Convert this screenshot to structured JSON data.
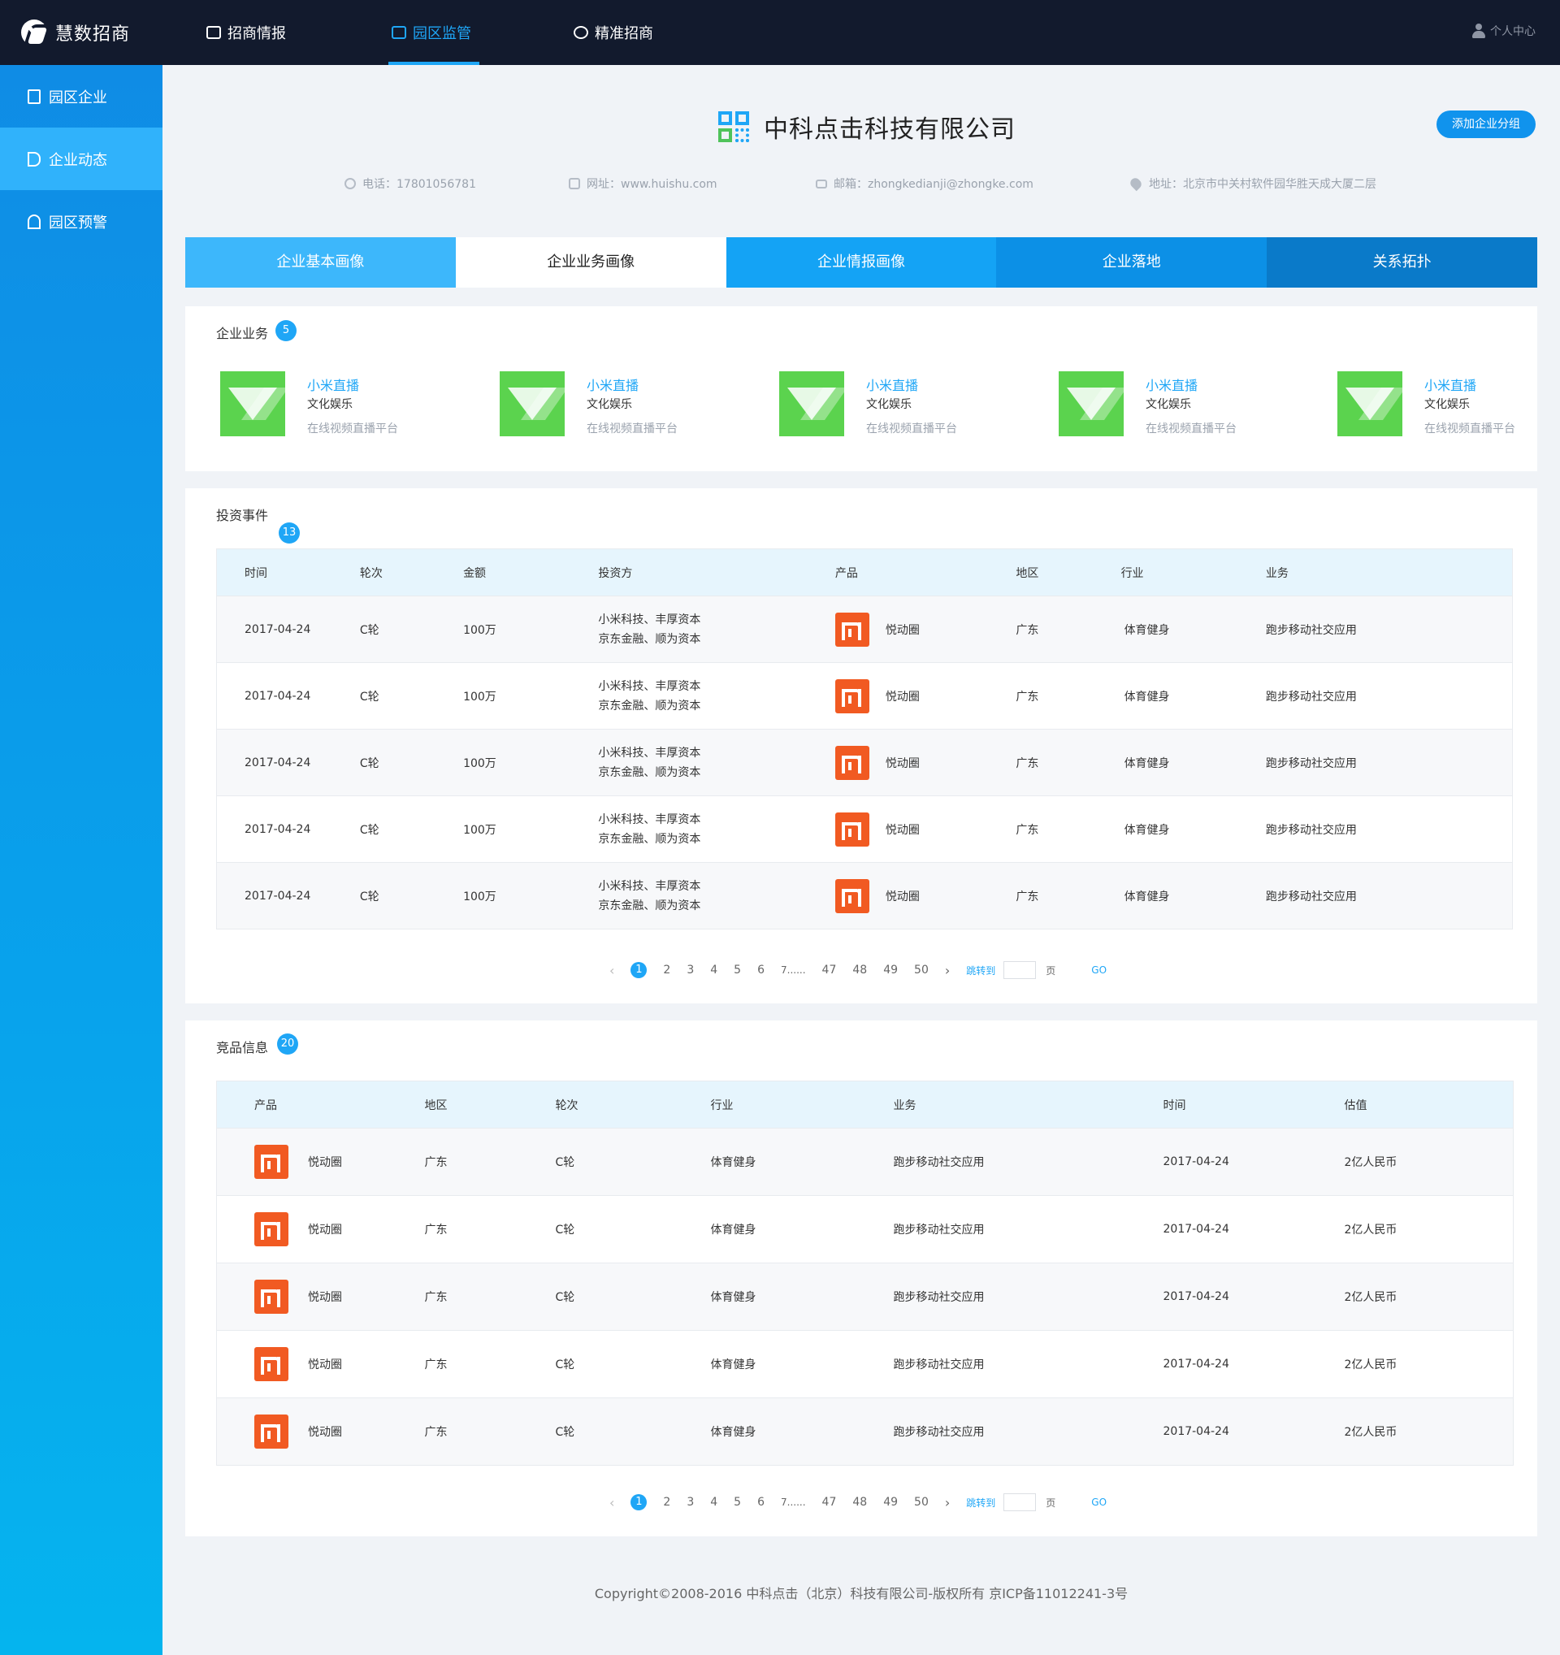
{
  "app": {
    "name": "慧数招商"
  },
  "topnav": [
    {
      "label": "招商情报",
      "icon": "briefcase-icon",
      "active": false
    },
    {
      "label": "园区监管",
      "icon": "buildings-icon",
      "active": true
    },
    {
      "label": "精准招商",
      "icon": "target-icon",
      "active": false
    }
  ],
  "user": {
    "label": "个人中心"
  },
  "sidebar": {
    "items": [
      {
        "label": "园区企业",
        "icon": "building-icon"
      },
      {
        "label": "企业动态",
        "icon": "speaker-icon",
        "active": true
      },
      {
        "label": "园区预警",
        "icon": "alarm-icon"
      }
    ]
  },
  "company": {
    "name": "中科点击科技有限公司",
    "add_group_label": "添加企业分组",
    "phone": "电话：17801056781",
    "website": "网址：www.huishu.com",
    "email": "邮箱：zhongkedianji@zhongke.com",
    "address": "地址：北京市中关村软件园华胜天成大厦二层"
  },
  "tabs": [
    {
      "label": "企业基本画像",
      "bg": "#3db7fb",
      "color": "#ffffff"
    },
    {
      "label": "企业业务画像",
      "bg": "#ffffff",
      "color": "#222222"
    },
    {
      "label": "企业情报画像",
      "bg": "#14a3f5",
      "color": "#ffffff"
    },
    {
      "label": "企业落地",
      "bg": "#0c90e6",
      "color": "#ffffff"
    },
    {
      "label": "关系拓扑",
      "bg": "#0a7ac9",
      "color": "#ffffff"
    }
  ],
  "business": {
    "title": "企业业务",
    "count": "5",
    "items": [
      {
        "name": "小米直播",
        "category": "文化娱乐",
        "desc": "在线视频直播平台"
      },
      {
        "name": "小米直播",
        "category": "文化娱乐",
        "desc": "在线视频直播平台"
      },
      {
        "name": "小米直播",
        "category": "文化娱乐",
        "desc": "在线视频直播平台"
      },
      {
        "name": "小米直播",
        "category": "文化娱乐",
        "desc": "在线视频直播平台"
      },
      {
        "name": "小米直播",
        "category": "文化娱乐",
        "desc": "在线视频直播平台"
      }
    ]
  },
  "investments": {
    "title": "投资事件",
    "count": "13",
    "headers": [
      "时间",
      "轮次",
      "金额",
      "投资方",
      "产品",
      "地区",
      "行业",
      "业务"
    ],
    "rows": [
      {
        "date": "2017-04-24",
        "round": "C轮",
        "amount": "100万",
        "investors1": "小米科技、丰厚资本",
        "investors2": "京东金融、顺为资本",
        "product": "悦动圈",
        "region": "广东",
        "industry": "体育健身",
        "business": "跑步移动社交应用"
      },
      {
        "date": "2017-04-24",
        "round": "C轮",
        "amount": "100万",
        "investors1": "小米科技、丰厚资本",
        "investors2": "京东金融、顺为资本",
        "product": "悦动圈",
        "region": "广东",
        "industry": "体育健身",
        "business": "跑步移动社交应用"
      },
      {
        "date": "2017-04-24",
        "round": "C轮",
        "amount": "100万",
        "investors1": "小米科技、丰厚资本",
        "investors2": "京东金融、顺为资本",
        "product": "悦动圈",
        "region": "广东",
        "industry": "体育健身",
        "business": "跑步移动社交应用"
      },
      {
        "date": "2017-04-24",
        "round": "C轮",
        "amount": "100万",
        "investors1": "小米科技、丰厚资本",
        "investors2": "京东金融、顺为资本",
        "product": "悦动圈",
        "region": "广东",
        "industry": "体育健身",
        "business": "跑步移动社交应用"
      },
      {
        "date": "2017-04-24",
        "round": "C轮",
        "amount": "100万",
        "investors1": "小米科技、丰厚资本",
        "investors2": "京东金融、顺为资本",
        "product": "悦动圈",
        "region": "广东",
        "industry": "体育健身",
        "business": "跑步移动社交应用"
      }
    ]
  },
  "competitors": {
    "title": "竞品信息",
    "count": "20",
    "headers": [
      "产品",
      "地区",
      "轮次",
      "行业",
      "业务",
      "时间",
      "估值"
    ],
    "rows": [
      {
        "product": "悦动圈",
        "region": "广东",
        "round": "C轮",
        "industry": "体育健身",
        "business": "跑步移动社交应用",
        "date": "2017-04-24",
        "valuation": "2亿人民币"
      },
      {
        "product": "悦动圈",
        "region": "广东",
        "round": "C轮",
        "industry": "体育健身",
        "business": "跑步移动社交应用",
        "date": "2017-04-24",
        "valuation": "2亿人民币"
      },
      {
        "product": "悦动圈",
        "region": "广东",
        "round": "C轮",
        "industry": "体育健身",
        "business": "跑步移动社交应用",
        "date": "2017-04-24",
        "valuation": "2亿人民币"
      },
      {
        "product": "悦动圈",
        "region": "广东",
        "round": "C轮",
        "industry": "体育健身",
        "business": "跑步移动社交应用",
        "date": "2017-04-24",
        "valuation": "2亿人民币"
      },
      {
        "product": "悦动圈",
        "region": "广东",
        "round": "C轮",
        "industry": "体育健身",
        "business": "跑步移动社交应用",
        "date": "2017-04-24",
        "valuation": "2亿人民币"
      }
    ]
  },
  "pagination": {
    "prev": "‹",
    "current": "1",
    "pages": [
      "2",
      "3",
      "4",
      "5",
      "6",
      "7......",
      "47",
      "48",
      "49",
      "50"
    ],
    "next": "›",
    "jump_label": "跳转到",
    "page_unit": "页",
    "go_label": "GO"
  },
  "footer": {
    "text": "Copyright©2008-2016 中科点击（北京）科技有限公司-版权所有  京ICP备11012241-3号"
  },
  "colors": {
    "accent": "#1fa6f6",
    "topbar": "#121a2d",
    "xiaomi": "#f15a22",
    "biz_logo": "#5bd34e"
  }
}
